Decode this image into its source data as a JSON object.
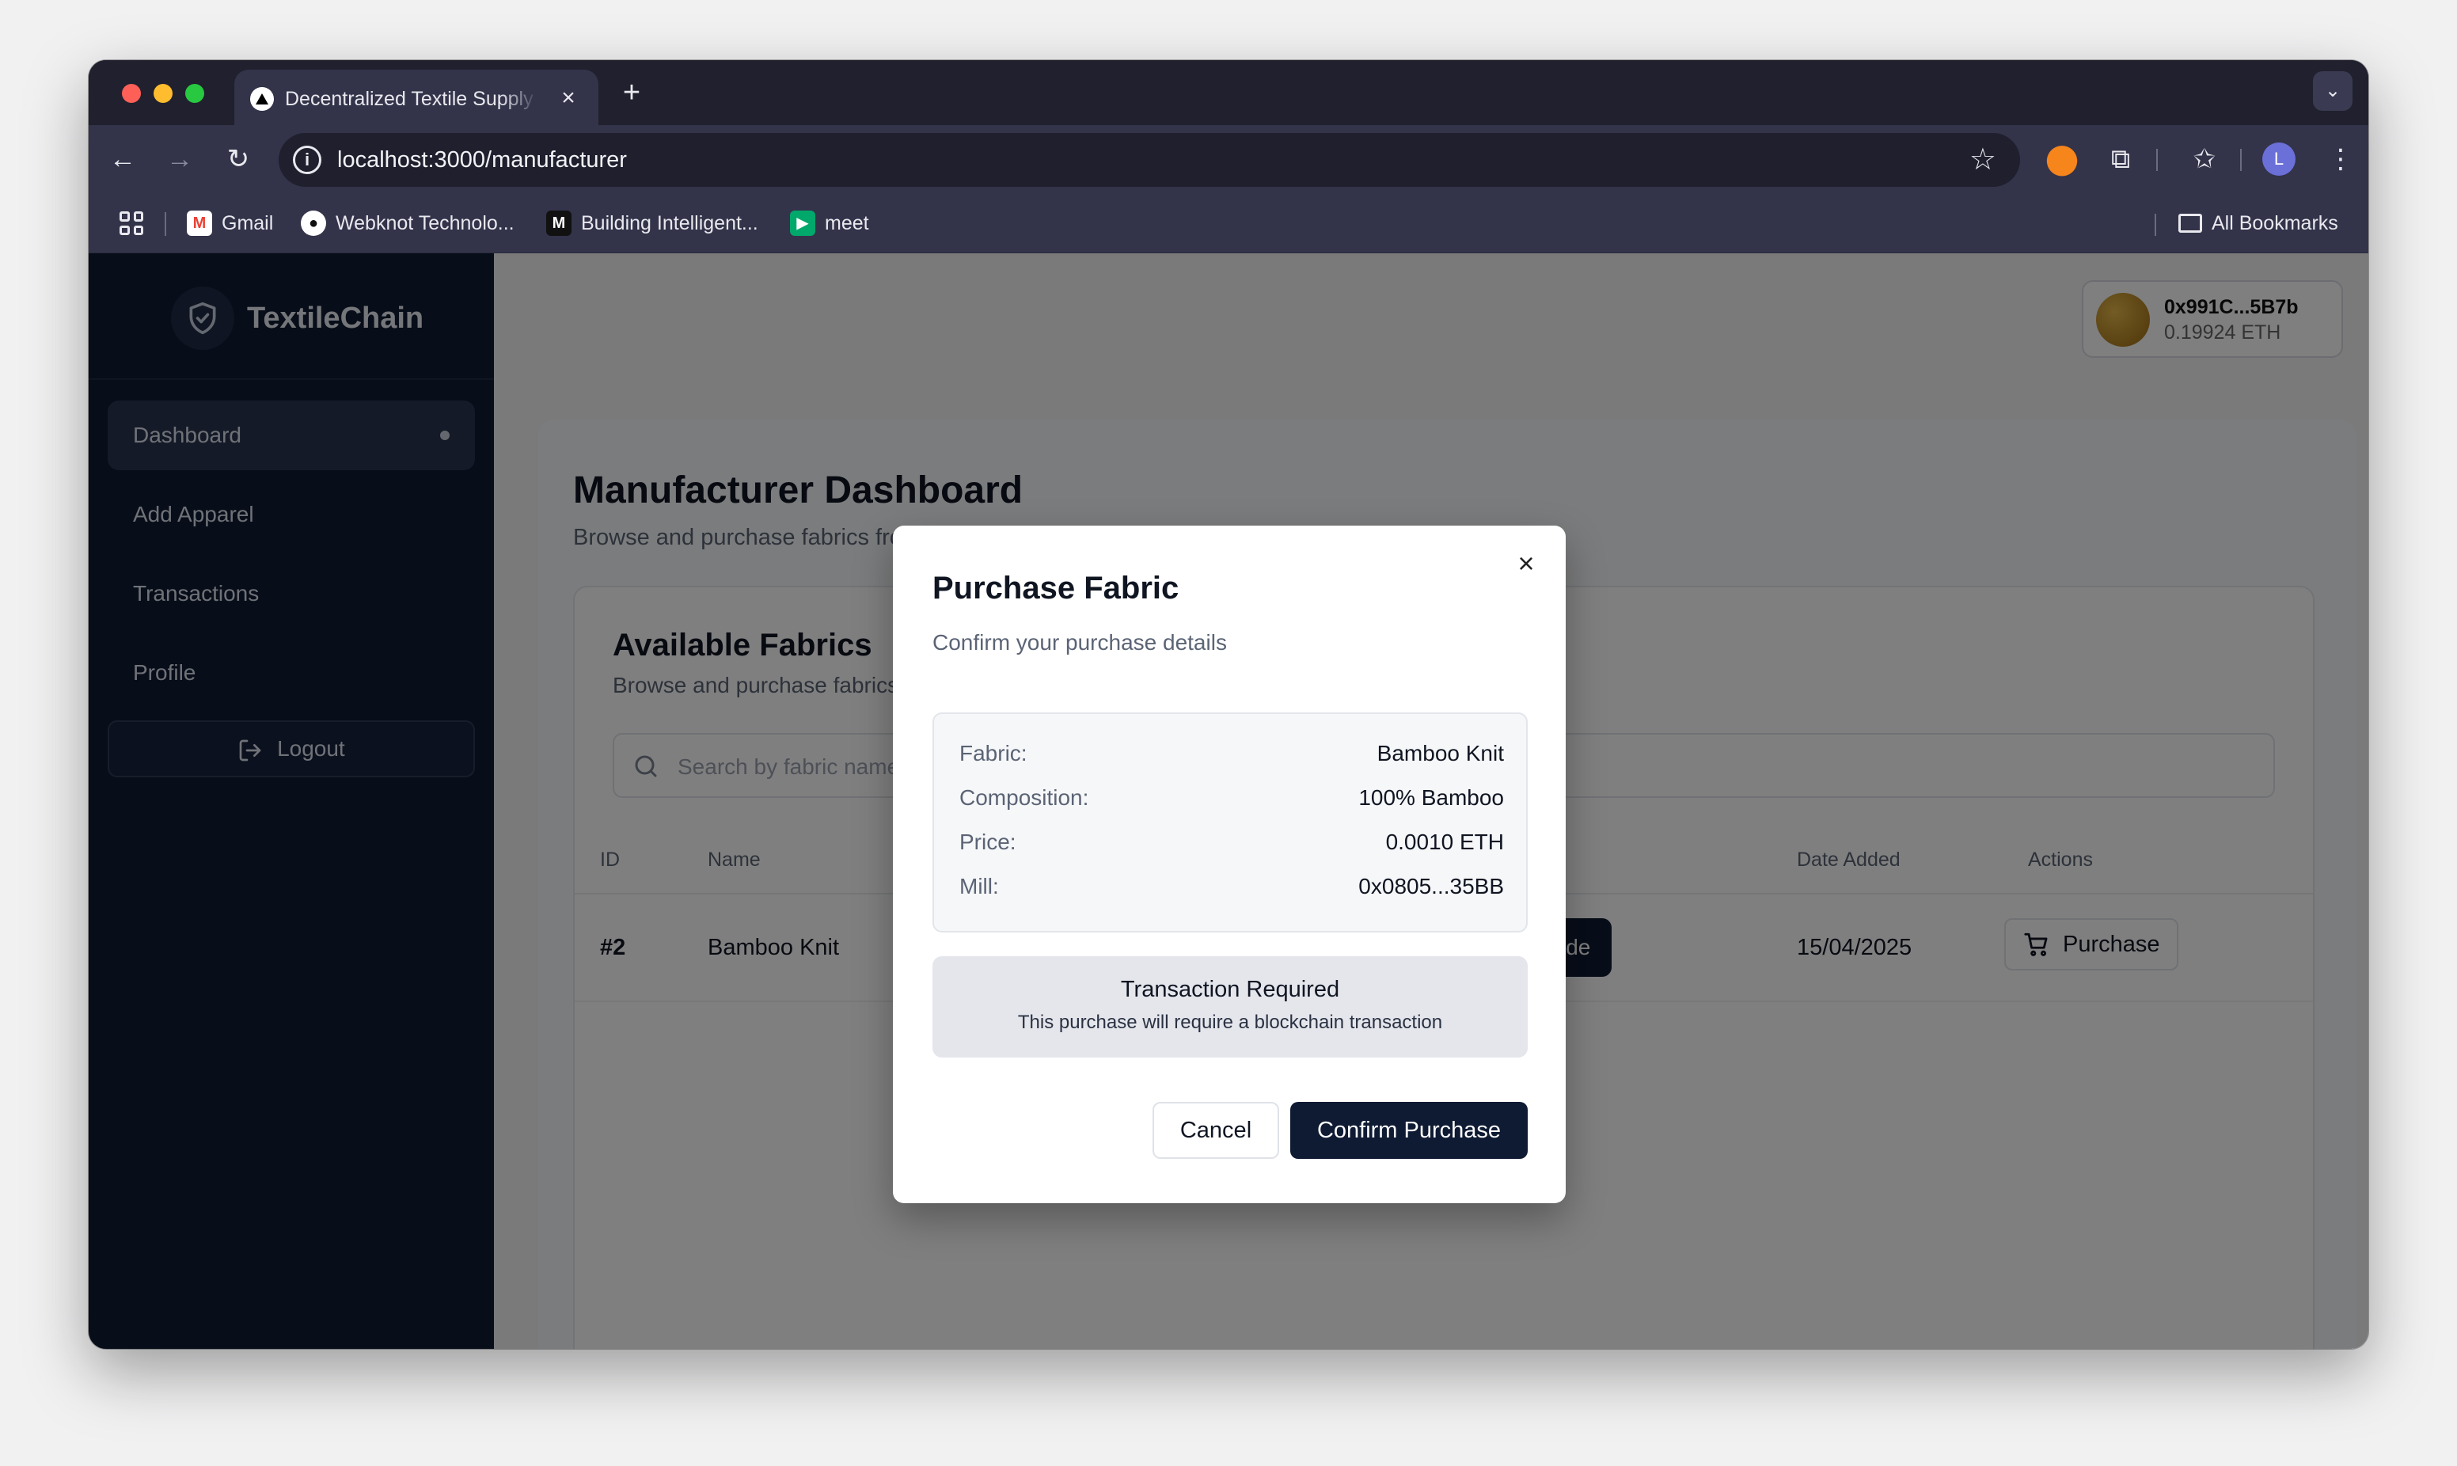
{
  "browser": {
    "tab_title": "Decentralized Textile Supply Chain",
    "url": "localhost:3000/manufacturer",
    "bookmarks": [
      {
        "label": "Gmail",
        "icon": "gmail-icon"
      },
      {
        "label": "Webknot Technolo...",
        "icon": "github-icon"
      },
      {
        "label": "Building Intelligent...",
        "icon": "medium-icon"
      },
      {
        "label": "meet",
        "icon": "meet-icon"
      }
    ],
    "all_bookmarks": "All Bookmarks",
    "profile_initial": "L"
  },
  "sidebar": {
    "brand": "TextileChain",
    "items": [
      {
        "label": "Dashboard",
        "active": true
      },
      {
        "label": "Add Apparel"
      },
      {
        "label": "Transactions"
      },
      {
        "label": "Profile"
      }
    ],
    "logout": "Logout"
  },
  "wallet": {
    "address": "0x991C...5B7b",
    "balance": "0.19924 ETH"
  },
  "main": {
    "title": "Manufacturer Dashboard",
    "subtitle": "Browse and purchase fabrics from mills",
    "card_title": "Available Fabrics",
    "card_subtitle": "Browse and purchase fabrics from mills",
    "search_placeholder": "Search by fabric name",
    "table": {
      "headers": [
        "ID",
        "Name",
        "Date Added",
        "Actions"
      ],
      "rows": [
        {
          "id": "#2",
          "name": "Bamboo Knit",
          "qr_label": "QR Code",
          "date": "15/04/2025",
          "action": "Purchase"
        }
      ]
    }
  },
  "modal": {
    "title": "Purchase Fabric",
    "subtitle": "Confirm your purchase details",
    "details": [
      {
        "label": "Fabric:",
        "value": "Bamboo Knit"
      },
      {
        "label": "Composition:",
        "value": "100% Bamboo"
      },
      {
        "label": "Price:",
        "value": "0.0010 ETH"
      },
      {
        "label": "Mill:",
        "value": "0x0805...35BB"
      }
    ],
    "notice_title": "Transaction Required",
    "notice_text": "This purchase will require a blockchain transaction",
    "cancel": "Cancel",
    "confirm": "Confirm Purchase"
  }
}
